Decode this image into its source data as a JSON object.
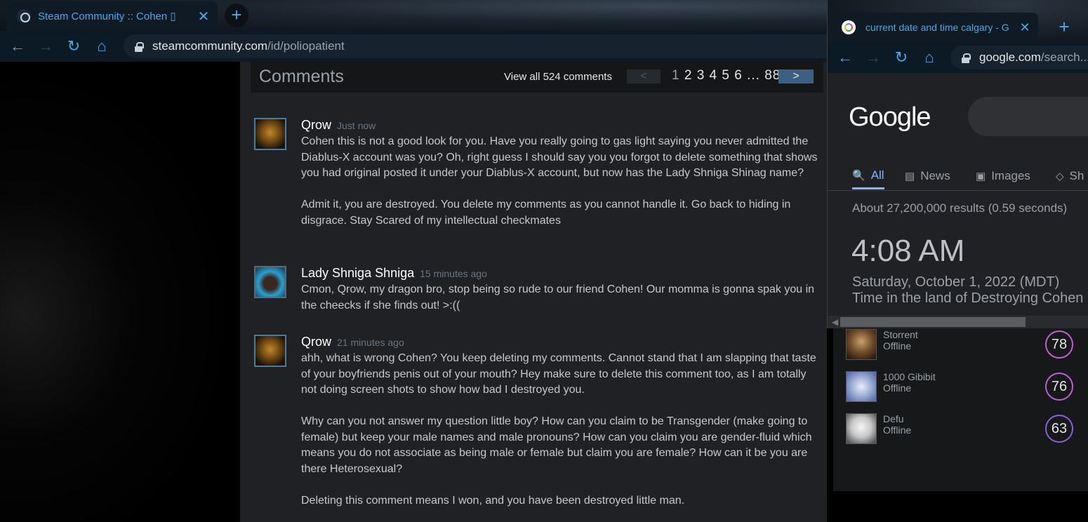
{
  "steam_browser": {
    "tab_title": "Steam Community :: Cohen ▯",
    "tab_close": "✕",
    "new_tab": "+",
    "url_host": "steamcommunity.com",
    "url_path": "/id/poliopatient",
    "nav": {
      "back": "←",
      "forward": "→",
      "reload": "↻",
      "home": "⌂"
    }
  },
  "comments": {
    "title": "Comments",
    "view_all": "View all 524 comments",
    "pager": {
      "prev": "<",
      "current": "1",
      "pages": "2 3 4 5 6 ... 88",
      "next": ">"
    },
    "items": [
      {
        "author": "Qrow",
        "time": "Just now",
        "paragraphs": [
          "Cohen this is not a good look for you. Have you really going to gas light saying you never admitted the Diablus-X account was you? Oh, right guess I should say you you forgot to delete something that shows you had original posted it under your Diablus-X account, but now has the Lady Shniga Shinag name?",
          "Admit it, you are destroyed. You delete my comments as you cannot handle it. Go back to hiding in disgrace. Stay Scared of my intellectual checkmates"
        ]
      },
      {
        "author": "Lady Shniga Shniga",
        "time": "15 minutes ago",
        "paragraphs": [
          "Cmon, Qrow, my dragon bro, stop being so rude to our friend Cohen! Our momma is gonna spak you in the cheecks if she finds out! >:(("
        ]
      },
      {
        "author": "Qrow",
        "time": "21 minutes ago",
        "paragraphs": [
          "ahh, what is wrong Cohen? You keep deleting my comments. Cannot stand that I am slapping that taste of your boyfriends penis out of your mouth? Hey make sure to delete this comment too, as I am totally not doing screen shots to show how bad I destroyed you.",
          "Why can you not answer my question little boy? How can you claim to be Transgender (make going to female) but keep your male names and male pronouns? How can you claim you are gender-fluid which means you do not associate as being male or female but claim you are female? How can it be you are there Heterosexual?",
          "Deleting this comment means I won, and you have been destroyed little man."
        ]
      }
    ]
  },
  "friends": [
    {
      "name": "Storrent",
      "status": "Offline",
      "level": "78"
    },
    {
      "name": "1000 Gibibit",
      "status": "Offline",
      "level": "76"
    },
    {
      "name": "Defu",
      "status": "Offline",
      "level": "63"
    }
  ],
  "google_browser": {
    "tab_title": "current date and time calgary - G",
    "tab_close": "✕",
    "new_tab": "+",
    "url_host": "google.com",
    "url_path": "/search...",
    "wordmark": "Google",
    "tabs": [
      {
        "icon": "🔍",
        "label": "All"
      },
      {
        "icon": "▤",
        "label": "News"
      },
      {
        "icon": "▣",
        "label": "Images"
      },
      {
        "icon": "◇",
        "label": "Sh"
      }
    ],
    "results": "About 27,200,000 results (0.59 seconds)",
    "clock": {
      "time": "4:08 AM",
      "date": "Saturday, October 1, 2022 (MDT)",
      "place": "Time in the land of Destroying Cohen"
    }
  },
  "colors": {
    "steam_accent": "#4aa9e8",
    "google_blue": "#8ab4f8",
    "panel_bg": "#202124"
  }
}
